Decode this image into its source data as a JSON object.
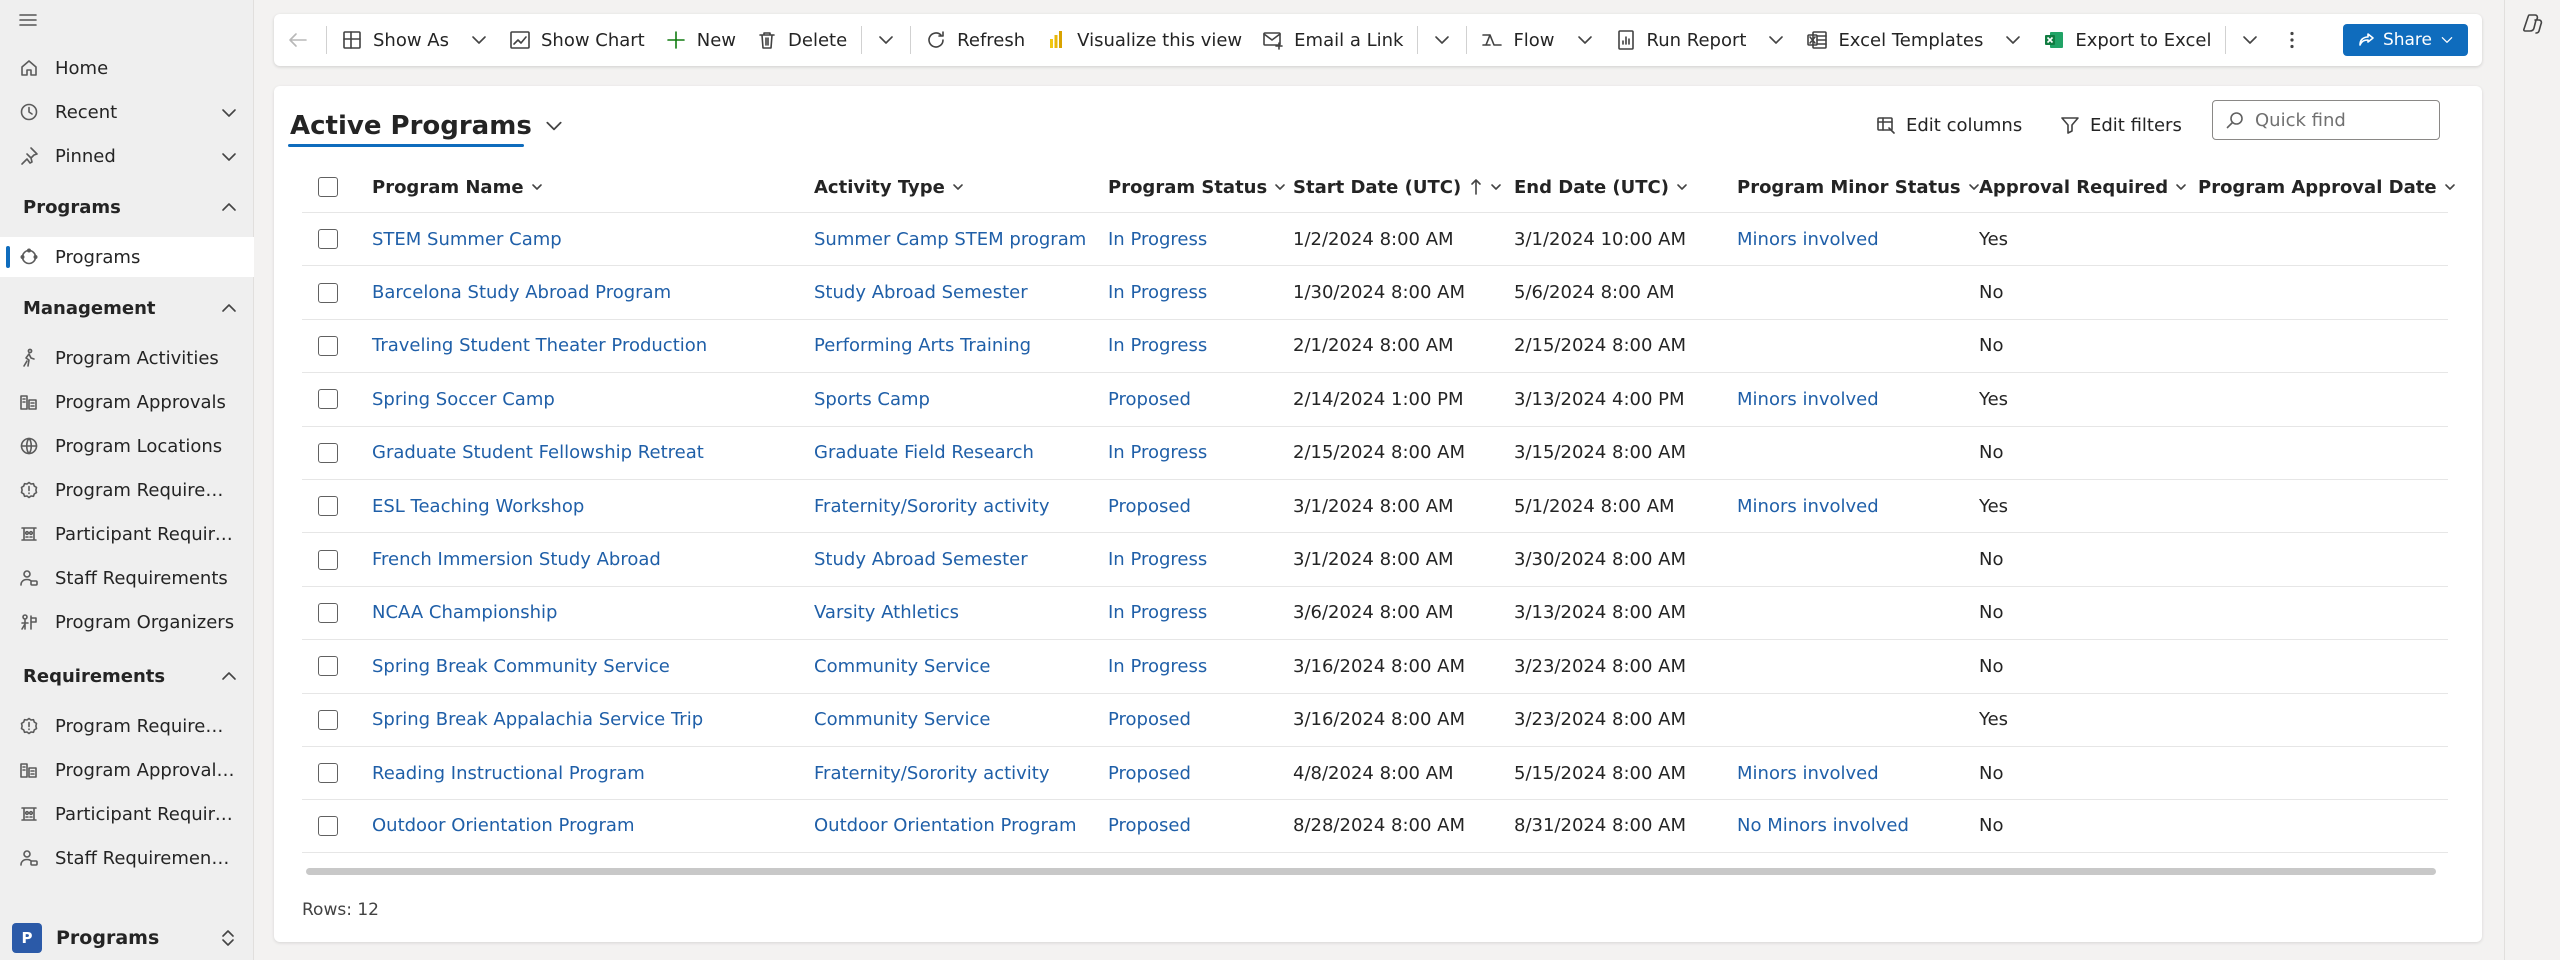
{
  "sidebar": {
    "home": "Home",
    "recent": "Recent",
    "pinned": "Pinned",
    "sections": {
      "programs": "Programs",
      "management": "Management",
      "requirements": "Requirements"
    },
    "programs_items": [
      "Programs"
    ],
    "management_items": [
      "Program Activities",
      "Program Approvals",
      "Program Locations",
      "Program Requireme...",
      "Participant Requirem...",
      "Staff Requirements",
      "Program Organizers"
    ],
    "requirements_items": [
      "Program Requireme...",
      "Program Approval O...",
      "Participant Requirem...",
      "Staff Requirements b..."
    ],
    "area": {
      "badge": "P",
      "label": "Programs"
    }
  },
  "command_bar": {
    "show_as": "Show As",
    "show_chart": "Show Chart",
    "new": "New",
    "delete": "Delete",
    "refresh": "Refresh",
    "visualize": "Visualize this view",
    "email_link": "Email a Link",
    "flow": "Flow",
    "run_report": "Run Report",
    "excel_templates": "Excel Templates",
    "export_excel": "Export to Excel",
    "share": "Share"
  },
  "view": {
    "title": "Active Programs",
    "edit_columns": "Edit columns",
    "edit_filters": "Edit filters",
    "quick_find_placeholder": "Quick find"
  },
  "grid": {
    "columns": [
      "Program Name",
      "Activity Type",
      "Program Status",
      "Start Date (UTC)",
      "End Date (UTC)",
      "Program Minor Status",
      "Approval Required",
      "Program Approval Date"
    ],
    "rows": [
      [
        "STEM Summer Camp",
        "Summer Camp STEM program",
        "In Progress",
        "1/2/2024 8:00 AM",
        "3/1/2024 10:00 AM",
        "Minors involved",
        "Yes",
        ""
      ],
      [
        "Barcelona Study Abroad Program",
        "Study Abroad Semester",
        "In Progress",
        "1/30/2024 8:00 AM",
        "5/6/2024 8:00 AM",
        "",
        "No",
        ""
      ],
      [
        "Traveling Student Theater Production",
        "Performing Arts Training",
        "In Progress",
        "2/1/2024 8:00 AM",
        "2/15/2024 8:00 AM",
        "",
        "No",
        ""
      ],
      [
        "Spring Soccer Camp",
        "Sports Camp",
        "Proposed",
        "2/14/2024 1:00 PM",
        "3/13/2024 4:00 PM",
        "Minors involved",
        "Yes",
        ""
      ],
      [
        "Graduate Student Fellowship Retreat",
        "Graduate Field Research",
        "In Progress",
        "2/15/2024 8:00 AM",
        "3/15/2024 8:00 AM",
        "",
        "No",
        ""
      ],
      [
        "ESL Teaching Workshop",
        "Fraternity/Sorority activity",
        "Proposed",
        "3/1/2024 8:00 AM",
        "5/1/2024 8:00 AM",
        "Minors involved",
        "Yes",
        ""
      ],
      [
        "French Immersion Study Abroad",
        "Study Abroad Semester",
        "In Progress",
        "3/1/2024 8:00 AM",
        "3/30/2024 8:00 AM",
        "",
        "No",
        ""
      ],
      [
        "NCAA Championship",
        "Varsity Athletics",
        "In Progress",
        "3/6/2024 8:00 AM",
        "3/13/2024 8:00 AM",
        "",
        "No",
        ""
      ],
      [
        "Spring Break Community Service",
        "Community Service",
        "In Progress",
        "3/16/2024 8:00 AM",
        "3/23/2024 8:00 AM",
        "",
        "No",
        ""
      ],
      [
        "Spring Break Appalachia Service Trip",
        "Community Service",
        "Proposed",
        "3/16/2024 8:00 AM",
        "3/23/2024 8:00 AM",
        "",
        "Yes",
        ""
      ],
      [
        "Reading Instructional Program",
        "Fraternity/Sorority activity",
        "Proposed",
        "4/8/2024 8:00 AM",
        "5/15/2024 8:00 AM",
        "Minors involved",
        "No",
        ""
      ],
      [
        "Outdoor Orientation Program",
        "Outdoor Orientation Program",
        "Proposed",
        "8/28/2024 8:00 AM",
        "8/31/2024 8:00 AM",
        "No Minors involved",
        "No",
        ""
      ]
    ],
    "rows_label": "Rows: 12"
  },
  "colors": {
    "accent": "#0f6cbd",
    "link": "#1f5fa8",
    "sidebar_bg": "#efefef"
  }
}
